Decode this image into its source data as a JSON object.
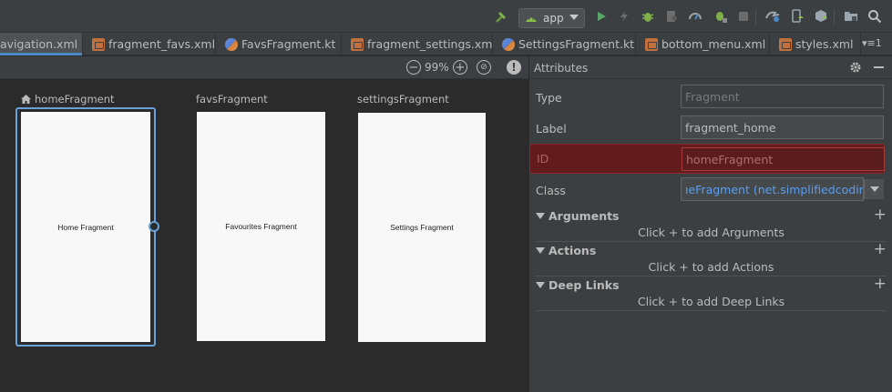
{
  "toolbar": {
    "run_config_label": "app",
    "icons": [
      "hammer-icon",
      "android-icon",
      "run-icon",
      "apply-changes-icon",
      "debug-icon",
      "profile-icon",
      "coverage-icon",
      "attach-debugger-icon",
      "stop-icon",
      "gradle-sync-icon",
      "avd-manager-icon",
      "sdk-manager-icon",
      "project-structure-icon",
      "search-icon"
    ]
  },
  "tabs": [
    {
      "label": "avigation.xml",
      "type": "xml",
      "active": true
    },
    {
      "label": "fragment_favs.xml",
      "type": "xml"
    },
    {
      "label": "FavsFragment.kt",
      "type": "kt"
    },
    {
      "label": "fragment_settings.xml",
      "type": "xml"
    },
    {
      "label": "SettingsFragment.kt",
      "type": "kt"
    },
    {
      "label": "bottom_menu.xml",
      "type": "xml"
    },
    {
      "label": "styles.xml",
      "type": "xml"
    }
  ],
  "tab_close": "✕",
  "tab_overflow": "▾≡1",
  "canvas": {
    "zoom": "99%",
    "fragments": [
      {
        "label": "homeFragment",
        "content": "Home Fragment",
        "start": true,
        "selected": true
      },
      {
        "label": "favsFragment",
        "content": "Favourites Fragment"
      },
      {
        "label": "settingsFragment",
        "content": "Settings Fragment"
      }
    ]
  },
  "attributes": {
    "title": "Attributes",
    "type_label": "Type",
    "type_value": "Fragment",
    "label_label": "Label",
    "label_value": "fragment_home",
    "id_label": "ID",
    "id_value": "homeFragment",
    "class_label": "Class",
    "class_value": "ıeFragment (net.simplifiedcoding)",
    "sections": [
      {
        "title": "Arguments",
        "hint": "Click + to add Arguments"
      },
      {
        "title": "Actions",
        "hint": "Click + to add Actions"
      },
      {
        "title": "Deep Links",
        "hint": "Click + to add Deep Links"
      }
    ]
  },
  "colors": {
    "accent": "#4a88c7",
    "error_bg": "#631b1b",
    "class_text": "#589df6",
    "selection": "#6aa1d8"
  }
}
